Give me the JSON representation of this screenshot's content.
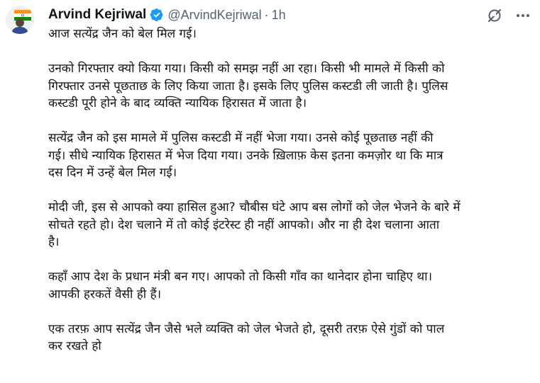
{
  "author": {
    "display_name": "Arvind Kejriwal",
    "handle": "@ArvindKejriwal",
    "separator": "·",
    "time": "1h",
    "verified_badge_color": "#1d9bf0"
  },
  "icons": {
    "verified": "verified-badge-icon",
    "grok": "grok-icon",
    "more": "more-options-icon"
  },
  "tweet": {
    "lines": [
      "आज सत्येंद्र जैन को बेल मिल गई।",
      "",
      "उनको गिरफ्तार क्यो किया गया। किसी को समझ नहीं आ रहा। किसी भी मामले में किसी को",
      "गिरफ्तार उनसे पूछताछ के लिए किया जाता है। इसके लिए पुलिस कस्टडी ली जाती है। पुलिस",
      "कस्टडी पूरी होने के बाद व्यक्ति न्यायिक हिरासत में जाता है।",
      "",
      "सत्येंद्र जैन को इस मामले में पुलिस कस्टडी में नहीं भेजा गया। उनसे कोई पूछताछ नहीं की",
      "गई। सीधे न्यायिक हिरासत में भेज दिया गया। उनके ख़िलाफ़ केस इतना कमज़ोर था कि मात्र",
      "दस दिन में उन्हें बेल मिल गई।",
      "",
      "मोदी जी, इस से आपको क्या हासिल हुआ? चौबीस घंटे आप बस लोगों को जेल भेजने के बारे में",
      "सोचते रहते हो। देश चलाने में तो कोई इंटरेस्ट ही नहीं आपको। और ना ही देश चलाना आता",
      "है।",
      "",
      "कहाँ आप देश के प्रधान मंत्री बन गए। आपको तो किसी गाँव का थानेदार होना चाहिए था।",
      "आपकी हरकतें वैसी ही हैं।",
      "",
      "एक तरफ़ आप सत्येंद्र जैन जैसे भले व्यक्ति को जेल भेजते हो, दूसरी तरफ़ ऐसे गुंडों को पाल",
      "कर रखते हो"
    ]
  }
}
